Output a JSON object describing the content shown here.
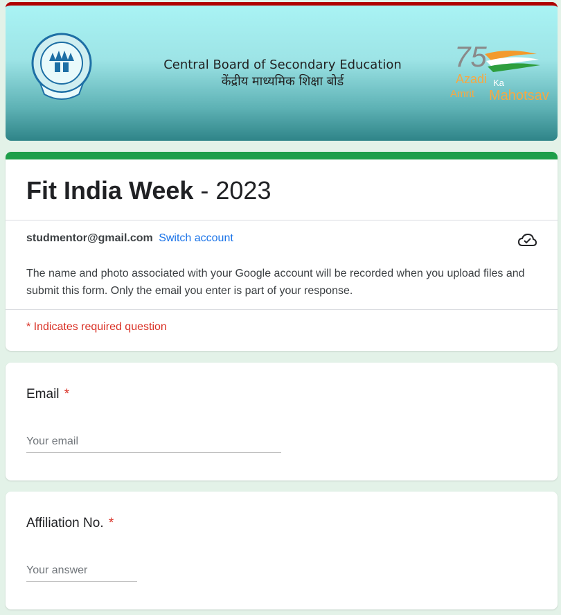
{
  "banner": {
    "title_en": "Central Board of Secondary Education",
    "title_hi": "केंद्रीय माध्यमिक शिक्षा बोर्ड",
    "logo_left": "cbse-emblem",
    "logo_right_lines": [
      "Azadi",
      "Ka",
      "Amrit",
      "Mahotsav"
    ],
    "logo_right_number": "75"
  },
  "form": {
    "title_bold": "Fit India Week",
    "title_rest": " - 2023",
    "account_email": "studmentor@gmail.com",
    "switch_account": "Switch account",
    "notice": "The name and photo associated with your Google account will be recorded when you upload files and submit this form. Only the email you enter is part of your response.",
    "required_note": "* Indicates required question"
  },
  "questions": [
    {
      "label": "Email",
      "required_mark": "*",
      "placeholder": "Your email"
    },
    {
      "label": "Affiliation No.",
      "required_mark": "*",
      "placeholder": "Your answer"
    }
  ],
  "colors": {
    "accent": "#1e9e4a",
    "link": "#1a73e8",
    "required": "#d93025",
    "background": "#e3f2e8"
  }
}
